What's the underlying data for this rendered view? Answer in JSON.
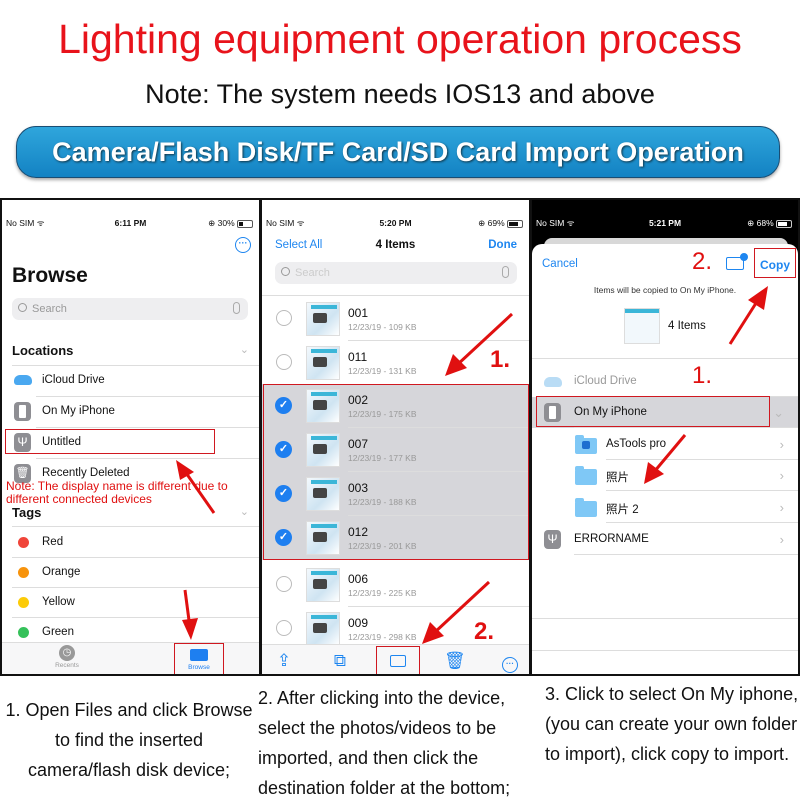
{
  "header": {
    "title": "Lighting equipment operation process",
    "subtitle": "Note: The system needs IOS13 and above",
    "banner": "Camera/Flash Disk/TF Card/SD Card Import Operation"
  },
  "colors": {
    "title_red": "#e8131b",
    "ios_blue": "#1e86f0",
    "banner_blue": "#1e93d2",
    "annotation_red": "#d01820"
  },
  "panel1": {
    "status": {
      "carrier": "No SIM",
      "time": "6:11 PM",
      "battery": "30%",
      "battery_fraction": 0.3
    },
    "more_icon": "ellipsis-circle-icon",
    "title": "Browse",
    "search_placeholder": "Search",
    "locations_header": "Locations",
    "locations": [
      {
        "label": "iCloud Drive",
        "icon": "cloud-icon"
      },
      {
        "label": "On My iPhone",
        "icon": "iphone-icon"
      },
      {
        "label": "Untitled",
        "icon": "usb-icon"
      },
      {
        "label": "Recently Deleted",
        "icon": "trash-icon"
      }
    ],
    "note": "Note: The display name is different due to different connected devices",
    "tags_header": "Tags",
    "tags": [
      {
        "label": "Red",
        "color": "#f0453a"
      },
      {
        "label": "Orange",
        "color": "#f7930c"
      },
      {
        "label": "Yellow",
        "color": "#fccb08"
      },
      {
        "label": "Green",
        "color": "#35c15a"
      }
    ],
    "tabbar": {
      "recents": "Recents",
      "browse": "Browse"
    }
  },
  "panel2": {
    "status": {
      "carrier": "No SIM",
      "time": "5:20 PM",
      "battery": "69%",
      "battery_fraction": 0.69
    },
    "select_all": "Select All",
    "title": "4 Items",
    "done": "Done",
    "search_placeholder": "Search",
    "files": [
      {
        "name": "001",
        "meta": "12/23/19 - 109 KB",
        "selected": false
      },
      {
        "name": "011",
        "meta": "12/23/19 - 131 KB",
        "selected": false
      },
      {
        "name": "002",
        "meta": "12/23/19 - 175 KB",
        "selected": true
      },
      {
        "name": "007",
        "meta": "12/23/19 - 177 KB",
        "selected": true
      },
      {
        "name": "003",
        "meta": "12/23/19 - 188 KB",
        "selected": true
      },
      {
        "name": "012",
        "meta": "12/23/19 - 201 KB",
        "selected": true
      },
      {
        "name": "006",
        "meta": "12/23/19 - 225 KB",
        "selected": false
      },
      {
        "name": "009",
        "meta": "12/23/19 - 298 KB",
        "selected": false
      }
    ],
    "step1": "1.",
    "step2": "2.",
    "toolbar": [
      "share-icon",
      "duplicate-icon",
      "folder-icon",
      "trash-icon",
      "ellipsis-circle-icon"
    ]
  },
  "panel3": {
    "status": {
      "carrier": "No SIM",
      "time": "5:21 PM",
      "battery": "68%",
      "battery_fraction": 0.68
    },
    "cancel": "Cancel",
    "copy": "Copy",
    "step2": "2.",
    "step1": "1.",
    "info": "Items will be copied to On My iPhone.",
    "items_count": "4 Items",
    "locations": [
      {
        "label": "iCloud Drive",
        "icon": "cloud-icon"
      },
      {
        "label": "On My iPhone",
        "icon": "iphone-icon",
        "selected": true
      },
      {
        "label": "AsTools pro",
        "icon": "app-folder-icon"
      },
      {
        "label": "照片",
        "icon": "folder-icon"
      },
      {
        "label": "照片 2",
        "icon": "folder-icon"
      },
      {
        "label": "ERRORNAME",
        "icon": "usb-icon"
      }
    ]
  },
  "descriptions": {
    "step1": "1. Open Files and click Browse to find the inserted camera/flash disk device;",
    "step2": "2. After clicking into the device, select the photos/videos to be imported, and then click the destination folder at the bottom;",
    "step3": "3. Click to select On My iphone, (you can create your own folder to import), click copy to import."
  }
}
